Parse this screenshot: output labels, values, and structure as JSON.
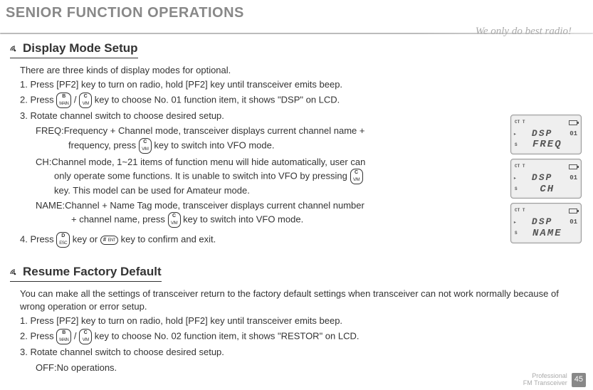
{
  "header": {
    "title": "SENIOR FUNCTION OPERATIONS",
    "slogan": "We only do best radio!"
  },
  "keys": {
    "b_main_top": "B",
    "b_main_bot": "MAIN",
    "c_vm_top": "C",
    "c_vm_bot": "V/M",
    "d_esc_top": "D",
    "d_esc_bot": "ESC",
    "enter_sharp": "#",
    "enter_ent": "ENT",
    "enter_lock": "⏏"
  },
  "section1": {
    "title": "Display Mode Setup",
    "intro": "There are three kinds of display modes for optional.",
    "step1": "1. Press [PF2] key to turn on radio, hold [PF2] key until transceiver emits beep.",
    "step2a": "2. Press ",
    "step2b": " / ",
    "step2c": " key to choose No. 01 function item, it shows \"DSP\" on LCD.",
    "step3": "3. Rotate channel switch to choose desired setup.",
    "freq_label": "FREQ: ",
    "freq_a": "Frequency + Channel mode, transceiver displays current channel name + ",
    "freq_b": "frequency, press ",
    "freq_c": " key to switch into VFO mode.",
    "ch_label": "CH: ",
    "ch_a": "Channel mode, 1~21 items of function menu will hide automatically, user can ",
    "ch_b": "only operate some functions. It is unable to switch into VFO by pressing ",
    "ch_c": "key. This model can be used for Amateur mode.",
    "name_label": "NAME: ",
    "name_a": "Channel + Name Tag mode, transceiver displays current channel number ",
    "name_b": "+ channel name, press ",
    "name_c": " key to switch into VFO mode.",
    "step4a": "4. Press ",
    "step4b": " key or ",
    "step4c": " key to confirm and exit."
  },
  "section2": {
    "title": "Resume Factory Default",
    "p1": "You can make all the settings of transceiver return to the factory default settings when transceiver can not work normally because of wrong operation or error setup.",
    "step1": "1. Press [PF2] key to turn on radio, hold [PF2] key until transceiver emits beep.",
    "step2a": "2. Press ",
    "step2b": " / ",
    "step2c": " key to choose No. 02 function item, it shows \"RESTOR\" on LCD.",
    "step3": "3. Rotate channel switch to choose desired setup.",
    "off_label": "OFF: ",
    "off_text": "No operations."
  },
  "lcd": {
    "ct": "CT",
    "t": "T",
    "s": "S",
    "ch": "01",
    "dsp": "DSP",
    "v1": "FREQ",
    "v2": "CH",
    "v3": "NAME",
    "arrow": "▸"
  },
  "footer": {
    "l1": "Professional",
    "l2": "FM Transceiver",
    "page": "45"
  }
}
